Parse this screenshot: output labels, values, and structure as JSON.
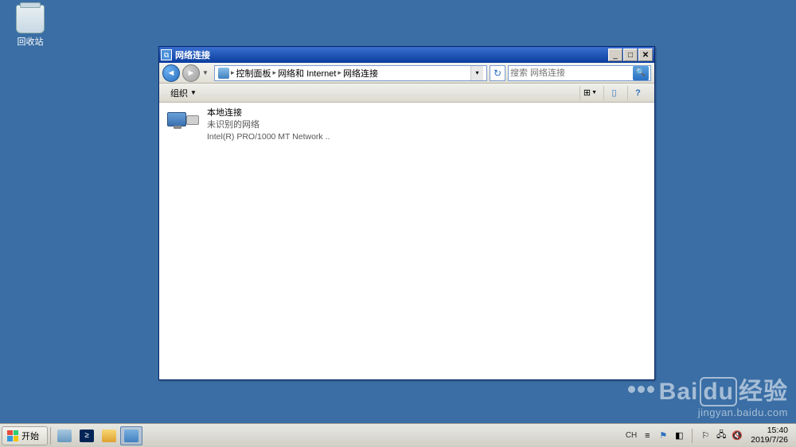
{
  "desktop": {
    "recycle_bin": "回收站"
  },
  "window": {
    "title": "网络连接",
    "breadcrumb": {
      "root": "控制面板",
      "l2": "网络和 Internet",
      "l3": "网络连接"
    },
    "search_placeholder": "搜索 网络连接",
    "cmdbar": {
      "organize": "组织"
    },
    "connection": {
      "name": "本地连接",
      "status": "未识别的网络",
      "device": "Intel(R) PRO/1000 MT Network .."
    }
  },
  "taskbar": {
    "start": "开始",
    "ime": "CH",
    "time": "15:40",
    "date": "2019/7/26"
  },
  "watermark": {
    "brand": "Bai",
    "brand2": "du",
    "label": "经验",
    "url": "jingyan.baidu.com"
  }
}
